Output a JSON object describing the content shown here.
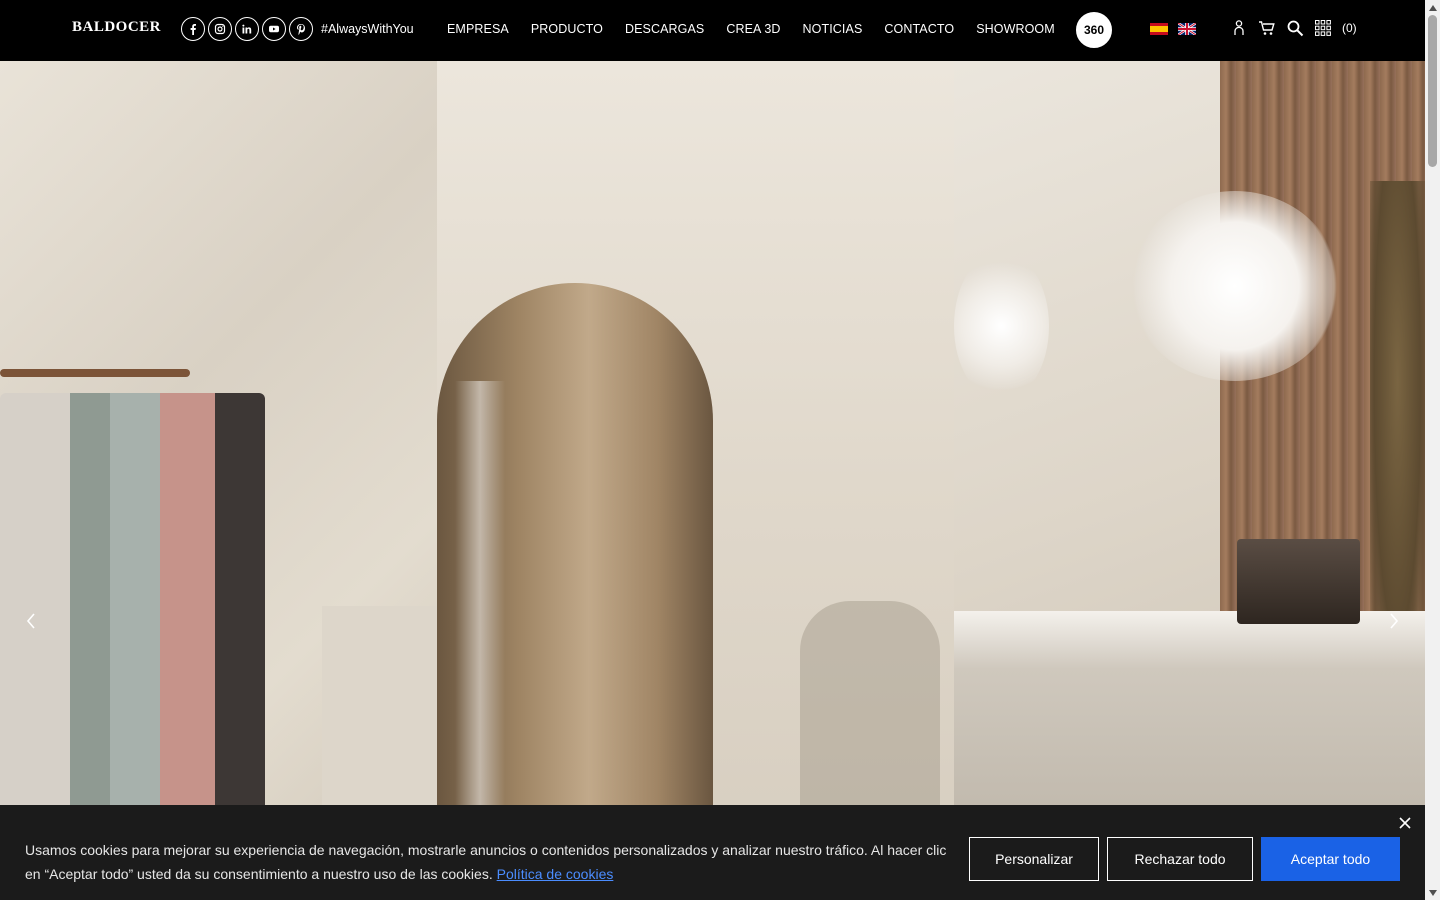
{
  "header": {
    "logo": "BALDOCER",
    "hashtag": "#AlwaysWithYou",
    "nav": [
      "EMPRESA",
      "PRODUCTO",
      "DESCARGAS",
      "CREA 3D",
      "NOTICIAS",
      "CONTACTO",
      "SHOWROOM"
    ],
    "badge_360": "360",
    "cart_count": "(0)",
    "socials": [
      "facebook-icon",
      "instagram-icon",
      "linkedin-icon",
      "youtube-icon",
      "pinterest-icon"
    ],
    "languages": [
      "es",
      "en"
    ]
  },
  "cookie": {
    "text": "Usamos cookies para mejorar su experiencia de navegación, mostrarle anuncios o contenidos personalizados y analizar nuestro tráfico. Al hacer clic en “Aceptar todo” usted da su consentimiento a nuestro uso de las cookies.",
    "policy_link": "Política de cookies",
    "personalizar": "Personalizar",
    "rechazar": "Rechazar todo",
    "aceptar": "Aceptar todo"
  },
  "colors": {
    "header_bg": "#000000",
    "cookie_bg": "#1b1b1b",
    "accept_button": "#1a62e6",
    "link": "#4b8dff"
  }
}
